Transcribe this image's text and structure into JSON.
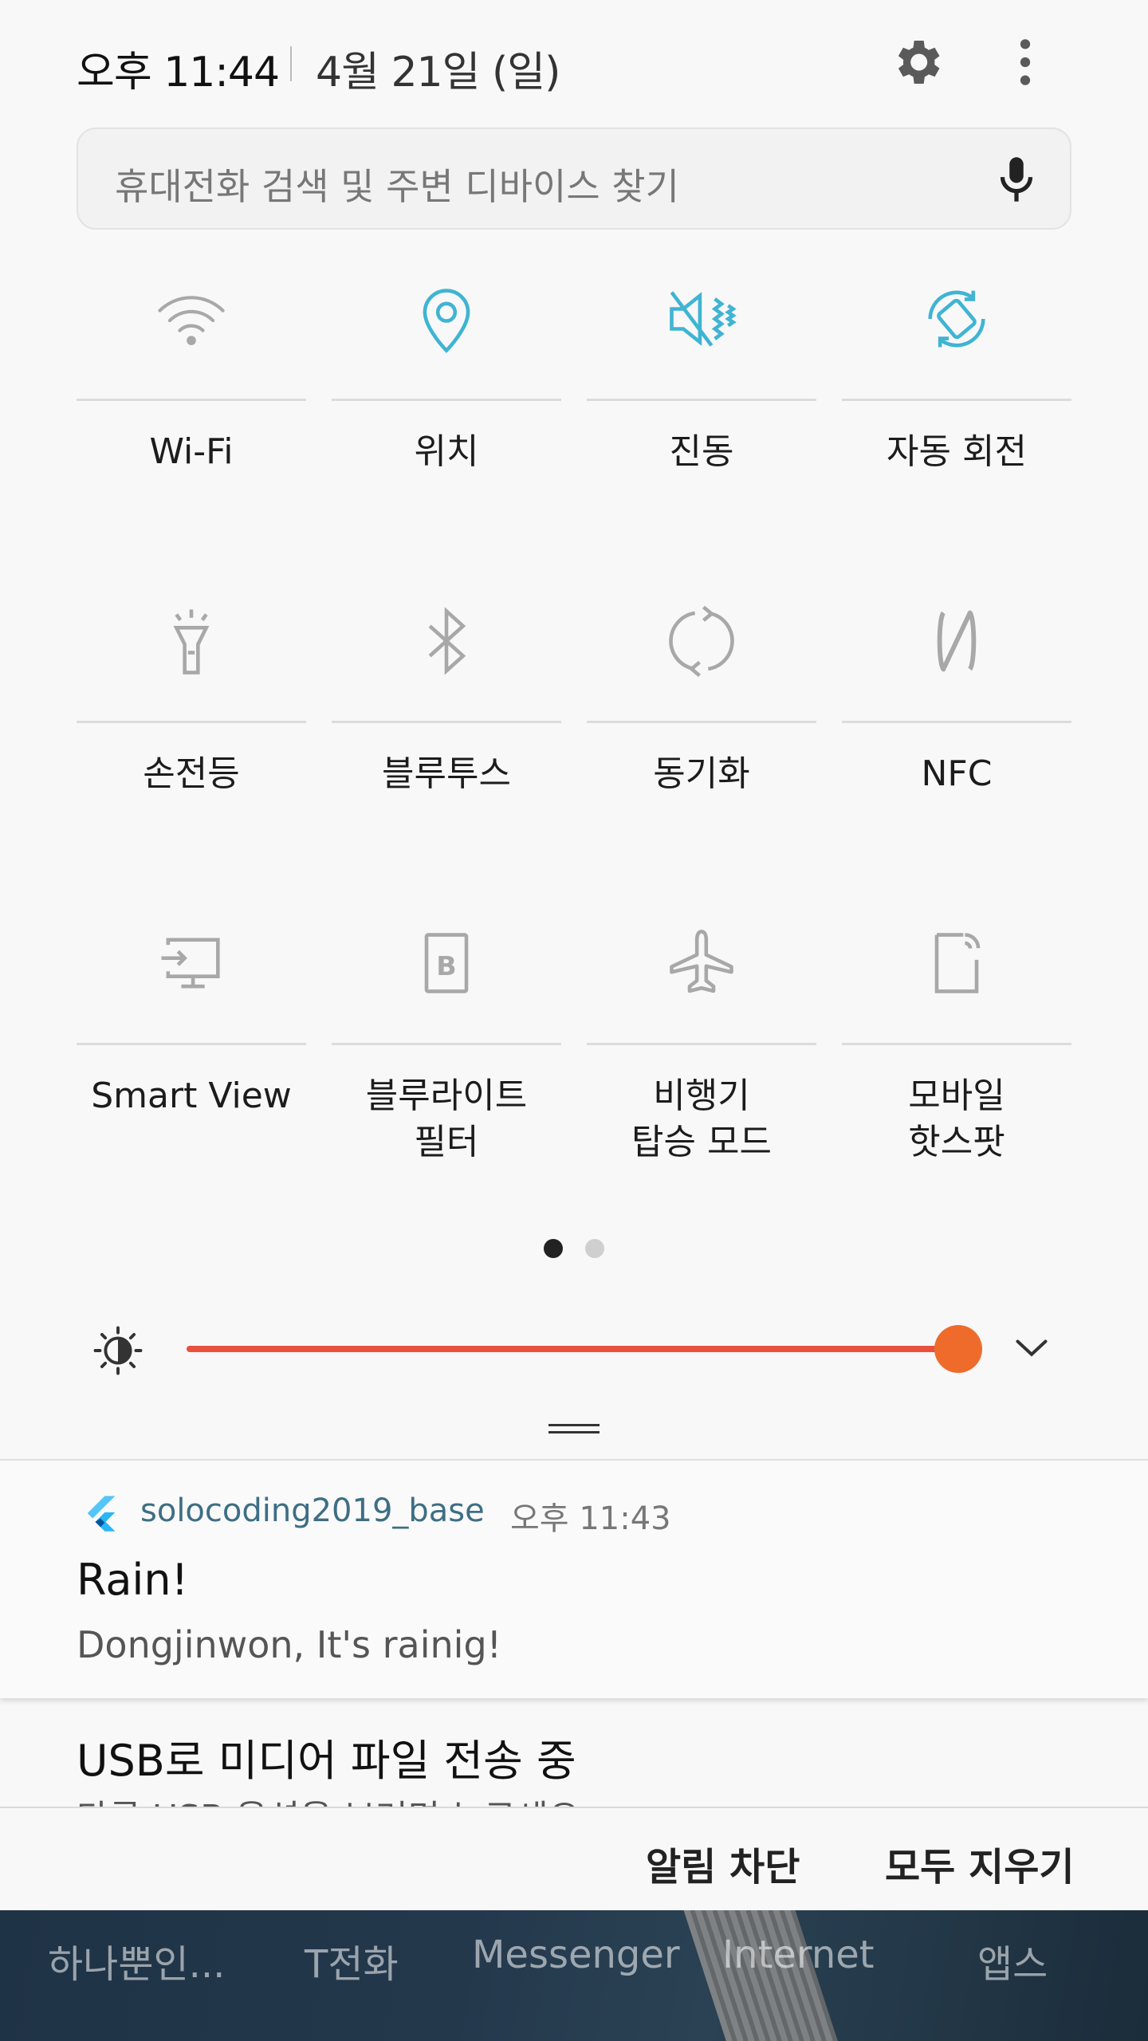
{
  "status": {
    "time": "오후 11:44",
    "date": "4월 21일 (일)"
  },
  "search": {
    "placeholder": "휴대전화 검색 및 주변 디바이스 찾기"
  },
  "tiles": [
    {
      "label": "Wi-Fi",
      "icon": "wifi-icon",
      "state": "off"
    },
    {
      "label": "위치",
      "icon": "location-icon",
      "state": "on"
    },
    {
      "label": "진동",
      "icon": "vibrate-icon",
      "state": "on"
    },
    {
      "label": "자동 회전",
      "icon": "auto-rotate-icon",
      "state": "on"
    },
    {
      "label": "손전등",
      "icon": "flashlight-icon",
      "state": "off"
    },
    {
      "label": "블루투스",
      "icon": "bluetooth-icon",
      "state": "off"
    },
    {
      "label": "동기화",
      "icon": "sync-icon",
      "state": "off"
    },
    {
      "label": "NFC",
      "icon": "nfc-icon",
      "state": "off"
    },
    {
      "label": "Smart View",
      "icon": "smart-view-icon",
      "state": "off"
    },
    {
      "label": "블루라이트\n필터",
      "icon": "blue-light-filter-icon",
      "state": "off"
    },
    {
      "label": "비행기\n탑승 모드",
      "icon": "airplane-icon",
      "state": "off"
    },
    {
      "label": "모바일\n핫스팟",
      "icon": "mobile-hotspot-icon",
      "state": "off"
    }
  ],
  "pages": {
    "current": 1,
    "total": 2
  },
  "brightness": {
    "level": 1.0
  },
  "notification": {
    "app": "solocoding2019_base",
    "time": "오후 11:43",
    "title": "Rain!",
    "body": "Dongjinwon, It's rainig!"
  },
  "usb": {
    "title": "USB로 미디어 파일 전송 중",
    "subtitle": "다른 USB 옵션을 보려면 누르세요."
  },
  "actions": {
    "block": "알림 차단",
    "clear_all": "모두 지우기"
  },
  "home_apps": [
    "하나뿐인...",
    "T전화",
    "Messenger",
    "Internet",
    "앱스"
  ],
  "colors": {
    "active_icon": "#3fb4d3",
    "inactive_icon": "#a8a8a8",
    "slider": "#e9513e",
    "knob": "#ee6b2b"
  }
}
